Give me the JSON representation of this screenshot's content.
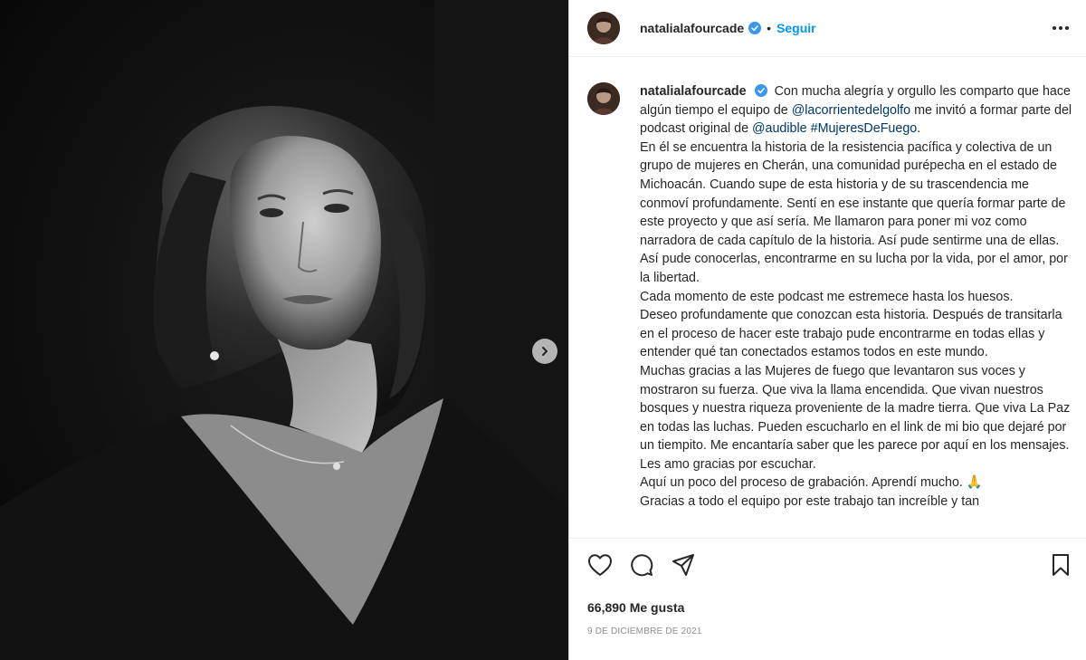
{
  "header": {
    "username": "natalialafourcade",
    "separator": "•",
    "follow_label": "Seguir"
  },
  "caption": {
    "username": "natalialafourcade",
    "seg1": "Con mucha alegría y orgullo les comparto que hace algún tiempo el equipo de",
    "mention1": "@lacorrientedelgolfo",
    "seg2": "me invitó a formar parte del podcast original de",
    "mention2": "@audible",
    "hashtag": "#MujeresDeFuego",
    "seg3": ".",
    "p2": "En él se encuentra la historia de la resistencia pacífica y colectiva de un grupo de mujeres en Cherán, una comunidad purépecha en el estado de Michoacán. Cuando supe de esta historia y de su trascendencia me conmoví profundamente. Sentí en ese instante que quería formar parte de este proyecto y que así sería. Me llamaron para poner mi voz como narradora de cada capítulo de la historia. Así pude sentirme una de ellas. Así pude conocerlas, encontrarme en su lucha por la vida, por el amor, por la libertad.",
    "p3": "Cada momento de este podcast me estremece hasta los huesos.",
    "p4": "Deseo profundamente que conozcan esta historia. Después de transitarla en el proceso de hacer este trabajo pude encontrarme en todas ellas y entender qué tan conectados estamos todos en este mundo.",
    "p5": "Muchas gracias a las Mujeres de fuego que levantaron sus voces y mostraron su fuerza. Que viva la llama encendida. Que vivan nuestros bosques y nuestra riqueza proveniente de la madre tierra. Que viva La Paz en todas las luchas. Pueden escucharlo en el link de mi bio que dejaré por un tiempito. Me encantaría saber que les parece por aquí en los mensajes. Les amo gracias por escuchar.",
    "p6": "Aquí un poco del proceso de grabación. Aprendí mucho. 🙏",
    "p7": "Gracias a todo el equipo por este trabajo tan increíble y tan"
  },
  "footer": {
    "likes": "66,890 Me gusta",
    "date": "9 DE DICIEMBRE DE 2021"
  },
  "icons": {
    "like": "heart-icon",
    "comment": "comment-icon",
    "share": "share-icon",
    "save": "bookmark-icon",
    "more": "more-options-icon",
    "next": "chevron-right-icon",
    "verified": "verified-badge-icon"
  },
  "colors": {
    "accent": "#0095f6",
    "link": "#00376b",
    "verified": "#3897f0"
  }
}
